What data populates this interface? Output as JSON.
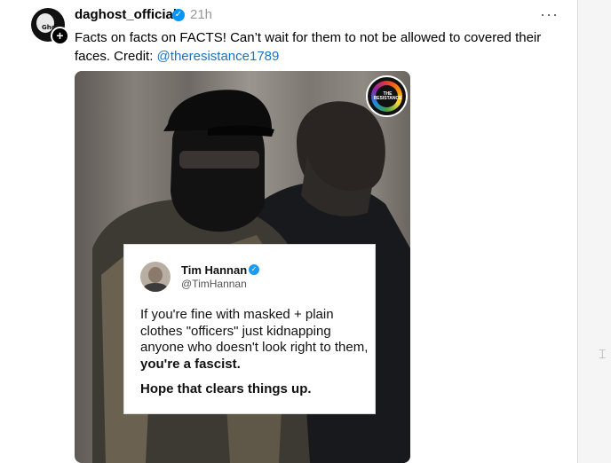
{
  "post": {
    "username": "daghost_official",
    "time": "21h",
    "more_label": "···",
    "caption_text": "Facts on facts on FACTS! Can’t wait for them to not be allowed to covered their faces. Credit: ",
    "caption_mention": "@theresistance1789",
    "avatar_text": "Ghost",
    "verified_icon": "verified-icon",
    "follow_icon": "plus-icon"
  },
  "media": {
    "badge_label": "THE RESISTANCE",
    "quote": {
      "name": "Tim Hannan",
      "handle": "@TimHannan",
      "body_plain": "If you're fine with masked + plain clothes \"officers\" just kidnapping anyone who doesn't look right to them, ",
      "body_bold": "you're a fascist.",
      "tail": "Hope that clears things up."
    }
  },
  "side": {
    "icon": "page-edge-icon",
    "icon_glyph": "⌶"
  },
  "colors": {
    "accent": "#0095f6",
    "link": "#1a73c6",
    "muted": "#999999"
  }
}
